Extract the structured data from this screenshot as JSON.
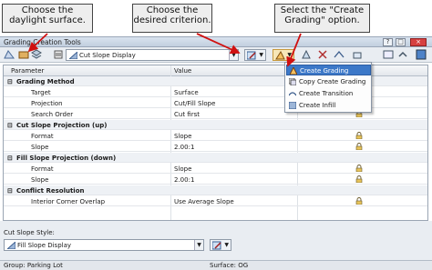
{
  "callouts": {
    "c1": "Choose the daylight surface.",
    "c2": "Choose the desired criterion.",
    "c3": "Select the \"Create Grading\" option."
  },
  "window": {
    "title": "Grading Creation Tools"
  },
  "toolbar": {
    "criteria_combo": "Cut Slope Display"
  },
  "grid": {
    "headers": [
      "Parameter",
      "Value"
    ],
    "rows": [
      {
        "type": "cat",
        "label": "Grading Method",
        "value": ""
      },
      {
        "type": "prop",
        "label": "Target",
        "value": "Surface",
        "lock": true
      },
      {
        "type": "prop",
        "label": "Projection",
        "value": "Cut/Fill Slope",
        "lock": true
      },
      {
        "type": "prop",
        "label": "Search Order",
        "value": "Cut first",
        "lock": true
      },
      {
        "type": "cat",
        "label": "Cut Slope Projection (up)",
        "value": ""
      },
      {
        "type": "prop",
        "label": "Format",
        "value": "Slope",
        "lock": true
      },
      {
        "type": "prop",
        "label": "Slope",
        "value": "2.00:1",
        "lock": true
      },
      {
        "type": "cat",
        "label": "Fill Slope Projection (down)",
        "value": ""
      },
      {
        "type": "prop",
        "label": "Format",
        "value": "Slope",
        "lock": true
      },
      {
        "type": "prop",
        "label": "Slope",
        "value": "2.00:1",
        "lock": true
      },
      {
        "type": "cat",
        "label": "Conflict Resolution",
        "value": ""
      },
      {
        "type": "prop",
        "label": "Interior Corner Overlap",
        "value": "Use Average Slope",
        "lock": true
      }
    ]
  },
  "menu": {
    "items": [
      {
        "label": "Create Grading",
        "selected": true
      },
      {
        "label": "Copy Create Grading",
        "selected": false
      },
      {
        "label": "Create Transition",
        "selected": false
      },
      {
        "label": "Create Infill",
        "selected": false
      }
    ]
  },
  "bottom": {
    "style_label": "Cut Slope Style:",
    "style_value": "Fill Slope Display"
  },
  "status": {
    "group": "Group: Parking Lot",
    "surface": "Surface: OG"
  }
}
